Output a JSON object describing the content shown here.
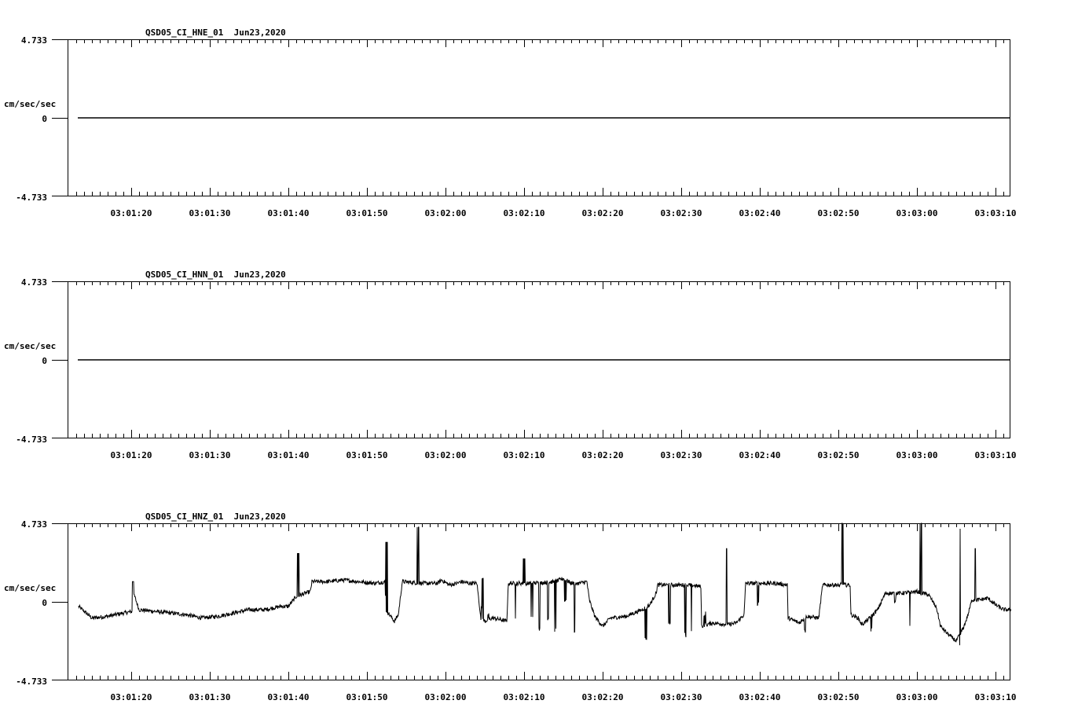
{
  "chart_data": [
    {
      "type": "line",
      "title": "QSD05_CI_HNE_01  Jun23,2020",
      "ylabel": "cm/sec/sec",
      "ylim": [
        -4.733,
        4.733
      ],
      "y_ticks": [
        "4.733",
        "0",
        "-4.733"
      ],
      "x_ticks": [
        "03:01:20",
        "03:01:30",
        "03:01:40",
        "03:01:50",
        "03:02:00",
        "03:02:10",
        "03:02:20",
        "03:02:30",
        "03:02:40",
        "03:02:50",
        "03:03:00",
        "03:03:10"
      ],
      "series": [
        {
          "kind": "flat",
          "values": [
            0,
            0
          ]
        }
      ]
    },
    {
      "type": "line",
      "title": "QSD05_CI_HNN_01  Jun23,2020",
      "ylabel": "cm/sec/sec",
      "ylim": [
        -4.733,
        4.733
      ],
      "y_ticks": [
        "4.733",
        "0",
        "-4.733"
      ],
      "x_ticks": [
        "03:01:20",
        "03:01:30",
        "03:01:40",
        "03:01:50",
        "03:02:00",
        "03:02:10",
        "03:02:20",
        "03:02:30",
        "03:02:40",
        "03:02:50",
        "03:03:00",
        "03:03:10"
      ],
      "series": [
        {
          "kind": "flat",
          "values": [
            0,
            0
          ]
        }
      ]
    },
    {
      "type": "line",
      "title": "QSD05_CI_HNZ_01  Jun23,2020",
      "ylabel": "cm/sec/sec",
      "ylim": [
        -4.733,
        4.733
      ],
      "y_ticks": [
        "4.733",
        "0",
        "-4.733"
      ],
      "x_ticks": [
        "03:01:20",
        "03:01:30",
        "03:01:40",
        "03:01:50",
        "03:02:00",
        "03:02:10",
        "03:02:20",
        "03:02:30",
        "03:02:40",
        "03:02:50",
        "03:03:00",
        "03:03:10"
      ],
      "series": [
        {
          "kind": "waveform",
          "time_start_s": 73.3,
          "time_end_s": 192,
          "knots": [
            [
              73.3,
              -0.3
            ],
            [
              75,
              -1.0
            ],
            [
              77,
              -0.9
            ],
            [
              79,
              -0.7
            ],
            [
              80.2,
              -0.6
            ],
            [
              80.3,
              0.5
            ],
            [
              81,
              -0.5
            ],
            [
              83,
              -0.6
            ],
            [
              85,
              -0.7
            ],
            [
              87,
              -0.8
            ],
            [
              89,
              -1.0
            ],
            [
              91,
              -0.9
            ],
            [
              93,
              -0.7
            ],
            [
              95,
              -0.5
            ],
            [
              97,
              -0.5
            ],
            [
              99,
              -0.3
            ],
            [
              100,
              -0.3
            ],
            [
              101,
              0.3
            ],
            [
              102.8,
              0.6
            ],
            [
              103,
              1.2
            ],
            [
              105,
              1.2
            ],
            [
              107,
              1.3
            ],
            [
              109,
              1.2
            ],
            [
              111,
              1.1
            ],
            [
              112.3,
              1.2
            ],
            [
              112.4,
              -0.5
            ],
            [
              113.5,
              -1.2
            ],
            [
              114,
              -0.8
            ],
            [
              114.5,
              1.2
            ],
            [
              117,
              1.1
            ],
            [
              119,
              1.1
            ],
            [
              119.5,
              1.3
            ],
            [
              120.5,
              1.0
            ],
            [
              121.5,
              1.1
            ],
            [
              122,
              1.2
            ],
            [
              123,
              1.1
            ],
            [
              124,
              1.1
            ],
            [
              124.5,
              -1.0
            ],
            [
              125,
              -1.2
            ],
            [
              126,
              -1.0
            ],
            [
              127,
              -1.1
            ],
            [
              127.8,
              -1.2
            ],
            [
              128,
              1.1
            ],
            [
              131,
              1.1
            ],
            [
              134,
              1.2
            ],
            [
              135,
              1.4
            ],
            [
              136,
              1.1
            ],
            [
              137,
              1.1
            ],
            [
              138,
              1.2
            ],
            [
              138.3,
              0.1
            ],
            [
              139,
              -0.9
            ],
            [
              140,
              -1.5
            ],
            [
              141,
              -1.0
            ],
            [
              143,
              -0.9
            ],
            [
              145,
              -0.5
            ],
            [
              146,
              -0.2
            ],
            [
              146.8,
              0.5
            ],
            [
              147,
              1.0
            ],
            [
              149,
              1.0
            ],
            [
              151,
              1.0
            ],
            [
              152.5,
              0.9
            ],
            [
              152.6,
              -1.5
            ],
            [
              154,
              -1.3
            ],
            [
              156,
              -1.4
            ],
            [
              157,
              -1.3
            ],
            [
              158,
              -0.8
            ],
            [
              158.2,
              1.1
            ],
            [
              160,
              1.1
            ],
            [
              162,
              1.1
            ],
            [
              163.5,
              1.0
            ],
            [
              163.6,
              -1.0
            ],
            [
              165,
              -1.3
            ],
            [
              166,
              -0.9
            ],
            [
              167.5,
              -1.0
            ],
            [
              168,
              1.0
            ],
            [
              170,
              1.0
            ],
            [
              171.5,
              1.0
            ],
            [
              171.6,
              -0.8
            ],
            [
              172.5,
              -1.0
            ],
            [
              173,
              -1.4
            ],
            [
              174,
              -1.0
            ],
            [
              175,
              -0.5
            ],
            [
              176,
              0.5
            ],
            [
              178,
              0.5
            ],
            [
              180,
              0.6
            ],
            [
              181.5,
              0.4
            ],
            [
              182,
              0.0
            ],
            [
              182.5,
              -0.4
            ],
            [
              183,
              -1.5
            ],
            [
              184,
              -2.0
            ],
            [
              185,
              -2.4
            ],
            [
              186,
              -1.5
            ],
            [
              186.5,
              -0.8
            ],
            [
              187,
              0.1
            ],
            [
              188,
              0.1
            ],
            [
              189,
              0.2
            ],
            [
              190,
              -0.2
            ],
            [
              191,
              -0.5
            ],
            [
              192,
              -0.5
            ]
          ],
          "dropouts": [
            [
              124.6,
              -0.3
            ],
            [
              125.6,
              -0.5
            ],
            [
              129,
              -1.0
            ],
            [
              130.2,
              -1.5
            ],
            [
              131,
              -0.8
            ],
            [
              132,
              -1.6
            ],
            [
              133,
              -1.0
            ],
            [
              134,
              -1.6
            ],
            [
              135.2,
              0.2
            ],
            [
              136.5,
              -1.7
            ],
            [
              145.6,
              -2.1
            ],
            [
              148.5,
              -1.1
            ],
            [
              150.6,
              -1.9
            ],
            [
              151.3,
              -1.5
            ],
            [
              153,
              -0.6
            ],
            [
              159.7,
              0.0
            ],
            [
              165.7,
              -1.7
            ],
            [
              170,
              -1.0
            ],
            [
              174.3,
              -1.6
            ],
            [
              177.2,
              0.2
            ],
            [
              179,
              -1.4
            ],
            [
              180.4,
              -1.8
            ],
            [
              185.5,
              -2.5
            ]
          ],
          "spikes": [
            [
              80.3,
              1.2
            ],
            [
              101.2,
              2.9
            ],
            [
              112.6,
              3.6
            ],
            [
              116.5,
              4.5
            ],
            [
              124.8,
              1.4
            ],
            [
              129.9,
              2.6
            ],
            [
              155.7,
              3.2
            ],
            [
              170.5,
              5.0
            ],
            [
              180.5,
              5.0
            ],
            [
              185.6,
              4.4
            ],
            [
              187.4,
              3.2
            ]
          ]
        }
      ]
    }
  ]
}
